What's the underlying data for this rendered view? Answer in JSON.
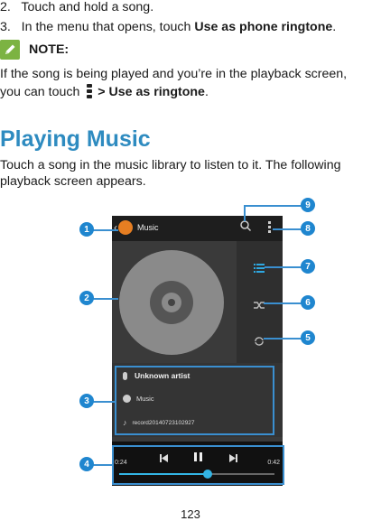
{
  "steps": [
    {
      "number": "2.",
      "text": "Touch and hold a song."
    },
    {
      "number": "3.",
      "text_before": "In the menu that opens, touch ",
      "text_bold": "Use as phone ringtone",
      "text_after": "."
    }
  ],
  "note": {
    "icon": "pencil-icon",
    "label": "NOTE:",
    "line1": "If the song is being played and you’re in the playback screen,",
    "line2_before": "you can touch ",
    "line2_icon": "menu-icon",
    "line2_bold": "> Use as ringtone",
    "line2_after": "."
  },
  "section": {
    "heading": "Playing Music",
    "para_line1": "Touch a song in the music library to listen to it. The following",
    "para_line2": "playback screen appears."
  },
  "phone": {
    "app_title": "Music",
    "artist": "Unknown artist",
    "album": "Music",
    "track": "record20140723102927",
    "elapsed": "0:24",
    "duration": "0:42",
    "progress": 0.57
  },
  "callouts": [
    "1",
    "2",
    "3",
    "4",
    "5",
    "6",
    "7",
    "8",
    "9"
  ],
  "colors": {
    "heading": "#2e8bc0",
    "callout": "#1f86cf",
    "note_icon": "#7cb342",
    "seek": "#33b5e5"
  },
  "page_number": "123"
}
